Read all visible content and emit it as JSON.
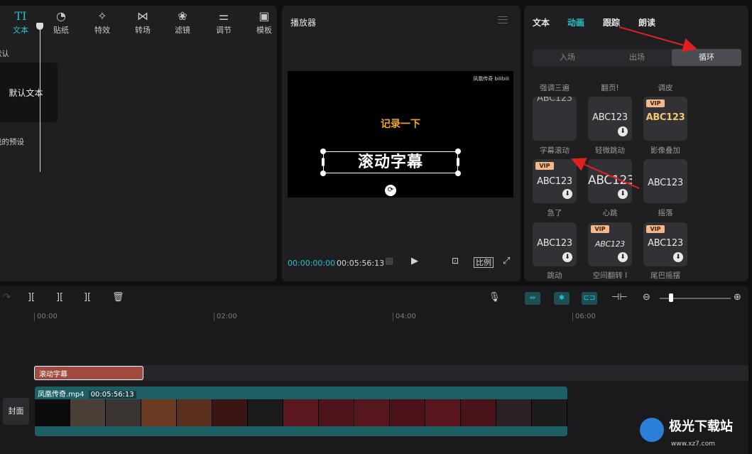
{
  "left_panel": {
    "tools": [
      {
        "icon": "text-icon",
        "glyph": "TI",
        "label": "文本",
        "active": true
      },
      {
        "icon": "sticker-icon",
        "glyph": "◔",
        "label": "贴纸"
      },
      {
        "icon": "effects-icon",
        "glyph": "✧",
        "label": "特效"
      },
      {
        "icon": "transition-icon",
        "glyph": "⋈",
        "label": "转场"
      },
      {
        "icon": "filter-icon",
        "glyph": "❀",
        "label": "滤镜"
      },
      {
        "icon": "adjust-icon",
        "glyph": "⚌",
        "label": "调节"
      },
      {
        "icon": "template-icon",
        "glyph": "▣",
        "label": "模板"
      }
    ],
    "default_label": "默认",
    "default_card": "默认文本",
    "my_presets_label": "我的预设"
  },
  "player": {
    "title": "播放器",
    "watermark": "凤凰传奇 bilibili",
    "overlay_title": "记录一下",
    "selected_text": "滚动字幕",
    "current_time": "00:00:00:00",
    "total_time": "00:05:56:13",
    "ratio_label": "比例"
  },
  "right_panel": {
    "tabs": [
      {
        "label": "文本"
      },
      {
        "label": "动画",
        "active": true
      },
      {
        "label": "跟踪"
      },
      {
        "label": "朗读"
      }
    ],
    "segments": [
      {
        "label": "入场"
      },
      {
        "label": "出场"
      },
      {
        "label": "循环",
        "active": true
      }
    ],
    "top_labels": [
      "强调三遍",
      "翻页!",
      "调皮"
    ],
    "cards": [
      {
        "text": "ABC123",
        "label": "字幕滚动",
        "vip": false,
        "download": false,
        "style": "scroll"
      },
      {
        "text": "ABC123",
        "label": "轻微跳动",
        "vip": false,
        "download": true,
        "style": "plain"
      },
      {
        "text": "ABC123",
        "label": "影像叠加",
        "vip": true,
        "download": false,
        "style": "gold"
      },
      {
        "text": "ABC123",
        "label": "急了",
        "vip": true,
        "download": true,
        "style": "plain"
      },
      {
        "text": "ABC123",
        "label": "心跳",
        "vip": false,
        "download": true,
        "style": "big"
      },
      {
        "text": "ABC123",
        "label": "摇落",
        "vip": false,
        "download": false,
        "style": "plain"
      },
      {
        "text": "ABC123",
        "label": "跳动",
        "vip": false,
        "download": true,
        "style": "plain"
      },
      {
        "text": "ABC123",
        "label": "空间翻转 I",
        "vip": true,
        "download": true,
        "style": "italic"
      },
      {
        "text": "ABC123",
        "label": "尾巴摇摆",
        "vip": true,
        "download": true,
        "style": "plain"
      }
    ],
    "vip_label": "VIP"
  },
  "timeline": {
    "ticks": [
      "00:00",
      "02:00",
      "04:00",
      "06:00"
    ],
    "text_clip": "滚动字幕",
    "cover_label": "封面",
    "video_name": "凤凰传奇.mp4",
    "video_duration": "00:05:56:13"
  },
  "watermark_logo": {
    "name": "极光下载站",
    "url": "www.xz7.com"
  },
  "colors": {
    "accent": "#23c3cc",
    "annotation_arrow": "#e02020",
    "text_clip": "#a0493e",
    "video_clip": "#1d5f64"
  }
}
